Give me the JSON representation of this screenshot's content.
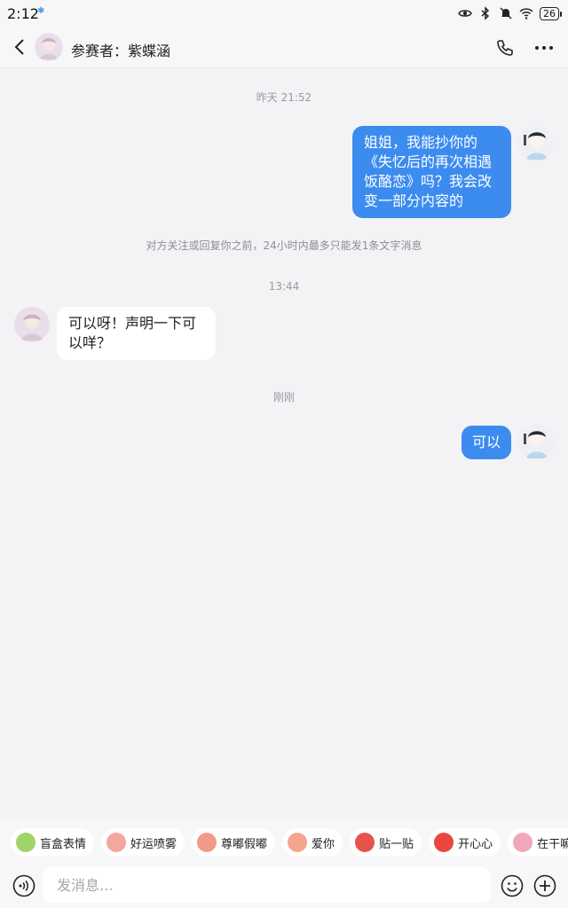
{
  "status_bar": {
    "time": "2:12",
    "battery": "26"
  },
  "header": {
    "title": "参赛者：紫蝶涵"
  },
  "chat": {
    "timestamp_1": "昨天 21:52",
    "msg_1": "姐姐，我能抄你的《失忆后的再次相遇饭酪恋》吗？我会改变一部分内容的",
    "notice": "对方关注或回复你之前，24小时内最多只能发1条文字消息",
    "timestamp_2": "13:44",
    "msg_2": "可以呀！声明一下可以咩？",
    "timestamp_3": "刚刚",
    "msg_3": "可以"
  },
  "quick_replies": [
    {
      "label": "盲盒表情",
      "icon": "blind-box-emoji",
      "color": "#9fd46a"
    },
    {
      "label": "好运喷雾",
      "icon": "lucky-spray-emoji",
      "color": "#f4a6a0"
    },
    {
      "label": "尊嘟假嘟",
      "icon": "really-emoji",
      "color": "#f29a8a"
    },
    {
      "label": "爱你",
      "icon": "love-you-emoji",
      "color": "#f6a48e"
    },
    {
      "label": "贴一贴",
      "icon": "cuddle-emoji",
      "color": "#e5544a"
    },
    {
      "label": "开心心",
      "icon": "happy-emoji",
      "color": "#e8463e"
    },
    {
      "label": "在干嘛",
      "icon": "what-doing-emoji",
      "color": "#f0a8b8"
    }
  ],
  "input": {
    "placeholder": "发消息…"
  },
  "colors": {
    "my_bubble": "#3c8cf0",
    "their_bubble": "#ffffff",
    "background": "#f3f3f5"
  }
}
